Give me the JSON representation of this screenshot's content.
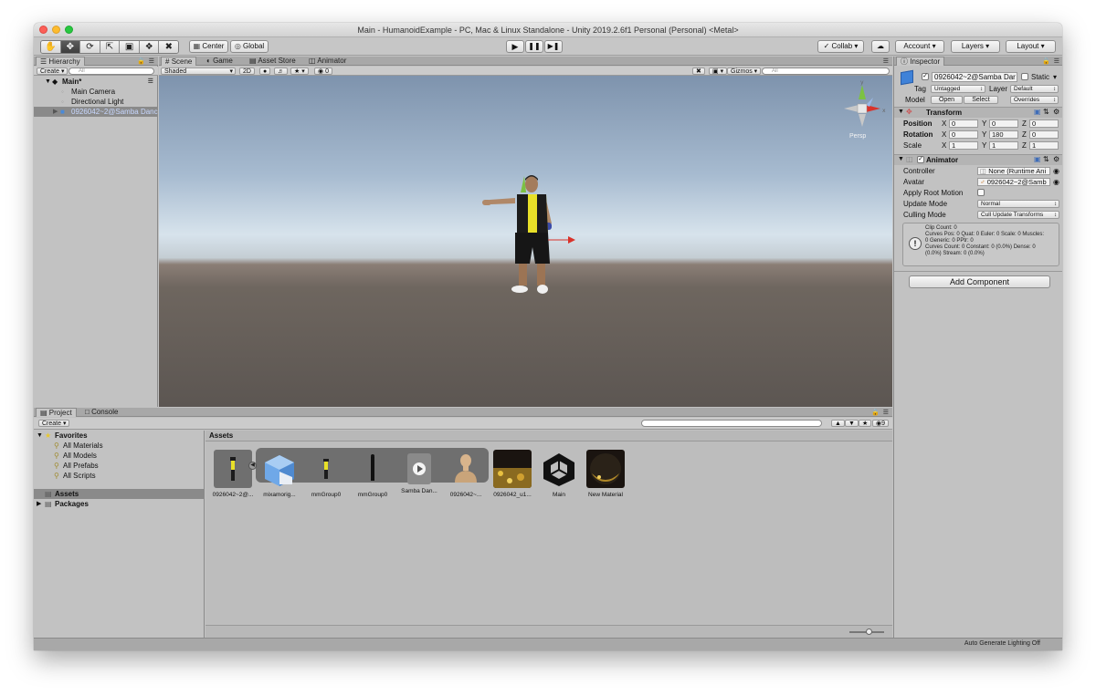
{
  "window": {
    "title": "Main - HumanoidExample - PC, Mac & Linux Standalone - Unity 2019.2.6f1 Personal (Personal) <Metal>"
  },
  "toolbar": {
    "tools": [
      "hand-tool",
      "move-tool",
      "rotate-tool",
      "scale-tool",
      "rect-tool",
      "transform-tool",
      "custom-tool"
    ],
    "pivot_label": "Center",
    "space_label": "Global",
    "collab_label": "Collab",
    "account_label": "Account",
    "layers_label": "Layers",
    "layout_label": "Layout"
  },
  "hierarchy": {
    "tab": "Hierarchy",
    "create": "Create",
    "search_placeholder": "All",
    "scene_name": "Main*",
    "items": [
      "Main Camera",
      "Directional Light",
      "0926042~2@Samba Danc"
    ]
  },
  "scene": {
    "tabs": [
      "Scene",
      "Game",
      "Asset Store",
      "Animator"
    ],
    "shading": "Shaded",
    "mode_2d": "2D",
    "hidden_count": "0",
    "gizmos": "Gizmos",
    "search_placeholder": "All",
    "persp_label": "Persp",
    "axis_y": "y",
    "axis_x": "x"
  },
  "inspector": {
    "tab": "Inspector",
    "object_name": "0926042~2@Samba Dar",
    "static_label": "Static",
    "tag_label": "Tag",
    "tag_value": "Untagged",
    "layer_label": "Layer",
    "layer_value": "Default",
    "model_label": "Model",
    "open_label": "Open",
    "select_label": "Select",
    "overrides_label": "Overrides",
    "transform": {
      "title": "Transform",
      "position_label": "Position",
      "rotation_label": "Rotation",
      "scale_label": "Scale",
      "position": {
        "x": "0",
        "y": "0",
        "z": "0"
      },
      "rotation": {
        "x": "0",
        "y": "180",
        "z": "0"
      },
      "scale": {
        "x": "1",
        "y": "1",
        "z": "1"
      }
    },
    "animator": {
      "title": "Animator",
      "controller_label": "Controller",
      "controller_value": "None (Runtime Ani",
      "avatar_label": "Avatar",
      "avatar_value": "0926042~2@Samb",
      "apply_root_motion_label": "Apply Root Motion",
      "update_mode_label": "Update Mode",
      "update_mode_value": "Normal",
      "culling_mode_label": "Culling Mode",
      "culling_mode_value": "Cull Update Transforms",
      "info_lines": [
        "Clip Count: 0",
        "Curves Pos: 0 Quat: 0 Euler: 0 Scale: 0 Muscles:",
        "0 Generic: 0 PPtr: 0",
        "Curves Count: 0 Constant: 0 (0.0%) Dense: 0",
        "(0.0%) Stream: 0 (0.0%)"
      ]
    },
    "add_component_label": "Add Component"
  },
  "project": {
    "tabs": [
      "Project",
      "Console"
    ],
    "create": "Create",
    "hidden_count": "9",
    "favorites_label": "Favorites",
    "favorites": [
      "All Materials",
      "All Models",
      "All Prefabs",
      "All Scripts"
    ],
    "assets_label": "Assets",
    "packages_label": "Packages",
    "assets_header": "Assets",
    "assets": [
      {
        "name": "0926042~2@...",
        "kind": "model"
      },
      {
        "name": "mixamorig...",
        "kind": "mesh-cube"
      },
      {
        "name": "mmGroup0",
        "kind": "figure"
      },
      {
        "name": "mmGroup0",
        "kind": "figure-dark"
      },
      {
        "name": "Samba Dan...",
        "kind": "animation-clip"
      },
      {
        "name": "0926042~...",
        "kind": "avatar"
      },
      {
        "name": "0926042_u1...",
        "kind": "texture"
      },
      {
        "name": "Main",
        "kind": "unity-scene"
      },
      {
        "name": "New Material",
        "kind": "material"
      }
    ]
  },
  "status": {
    "lighting": "Auto Generate Lighting Off"
  },
  "colors": {
    "window_bg": "#c2c2c2",
    "selection": "#8a8a8a",
    "axis_x": "#d9322a",
    "axis_y": "#7cc242",
    "axis_z": "#2f6bd8",
    "shirt_yellow": "#e8e028"
  }
}
